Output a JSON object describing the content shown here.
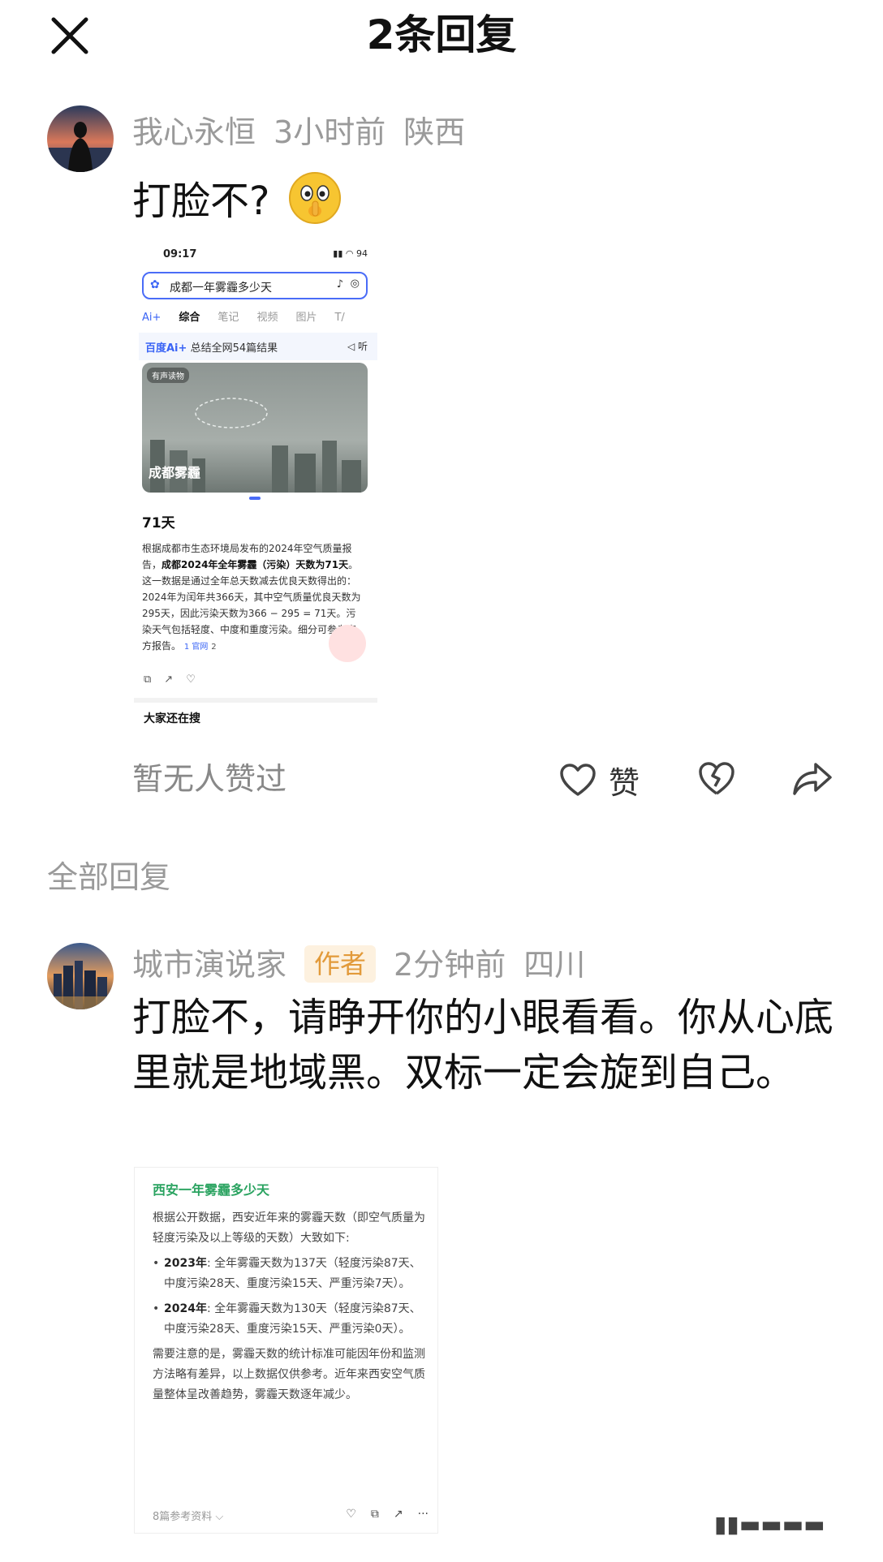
{
  "header": {
    "title": "2条回复"
  },
  "comment": {
    "username": "我心永恒",
    "time": "3小时前",
    "location": "陕西",
    "text": "打脸不?",
    "screenshot": {
      "status_time": "09:17",
      "battery": "94",
      "search_query": "成都一年雾霾多少天",
      "tabs": [
        "Ai+",
        "综合",
        "笔记",
        "视频",
        "图片",
        "T/"
      ],
      "summary_brand": "百度Ai+",
      "summary_text": "总结全网54篇结果",
      "listen_label": "◁ 听",
      "photo_tag": "有声读物",
      "photo_label": "成都雾霾",
      "answer": "71天",
      "para_1": "根据成都市生态环境局发布的2024年空气质量报告，",
      "para_bold": "成都2024年全年雾霾（污染）天数为71天",
      "para_2": "。这一数据是通过全年总天数减去优良天数得出的：2024年为闰年共366天，其中空气质量优良天数为295天，因此污染天数为366 − 295 = 71天。污染天气包括轻度、中度和重度污染。细分可参考官方报告。",
      "ref_label": "1 官网",
      "ref_count": "2",
      "more_label": "大家还在搜"
    }
  },
  "footer": {
    "no_likes": "暂无人赞过",
    "like_label": "赞"
  },
  "section": {
    "title": "全部回复"
  },
  "reply": {
    "username": "城市演说家",
    "badge": "作者",
    "time": "2分钟前",
    "location": "四川",
    "text": "打脸不，请睁开你的小眼看看。你从心底里就是地域黑。双标一定会旋到自己。",
    "screenshot": {
      "title": "西安一年雾霾多少天",
      "intro": "根据公开数据，西安近年来的雾霾天数（即空气质量为轻度污染及以上等级的天数）大致如下:",
      "item_1_year": "2023年",
      "item_1_text": ": 全年雾霾天数为137天（轻度污染87天、中度污染28天、重度污染15天、严重污染7天）。",
      "item_2_year": "2024年",
      "item_2_text": ": 全年雾霾天数为130天（轻度污染87天、中度污染28天、重度污染15天、严重污染0天）。",
      "note": "需要注意的是，雾霾天数的统计标准可能因年份和监测方法略有差异，以上数据仅供参考。近年来西安空气质量整体呈改善趋势，雾霾天数逐年减少。",
      "sources": "8篇参考资料 ⌵"
    }
  }
}
